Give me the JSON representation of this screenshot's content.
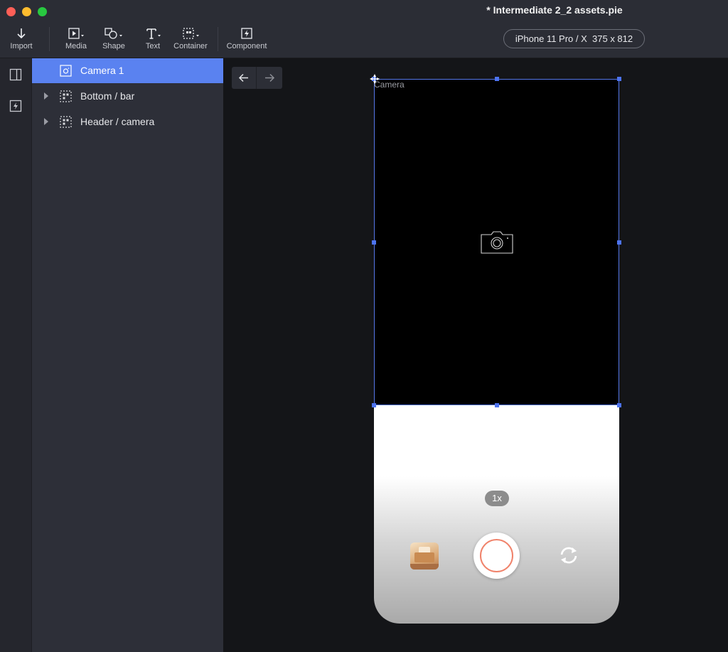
{
  "window": {
    "title": "* Intermediate 2_2 assets.pie"
  },
  "toolbar": {
    "import": {
      "label": "Import",
      "icon": "arrow-down-icon"
    },
    "media": {
      "label": "Media",
      "icon": "play-icon"
    },
    "shape": {
      "label": "Shape",
      "icon": "shape-icon"
    },
    "text": {
      "label": "Text",
      "icon": "text-icon"
    },
    "container": {
      "label": "Container",
      "icon": "container-icon"
    },
    "component": {
      "label": "Component",
      "icon": "lightning-icon"
    },
    "device": "iPhone 11 Pro / X  375 x 812"
  },
  "layers": [
    {
      "label": "Camera 1",
      "icon": "camera-layer-icon",
      "selected": true,
      "expandable": false
    },
    {
      "label": "Bottom / bar",
      "icon": "container-icon",
      "selected": false,
      "expandable": true
    },
    {
      "label": "Header / camera",
      "icon": "container-icon",
      "selected": false,
      "expandable": true
    }
  ],
  "canvas": {
    "selection_label": "Camera",
    "zoom_badge": "1x"
  },
  "colors": {
    "accent": "#5a82f0",
    "selection": "#4d73f0",
    "shutter_ring": "#f0826a"
  }
}
